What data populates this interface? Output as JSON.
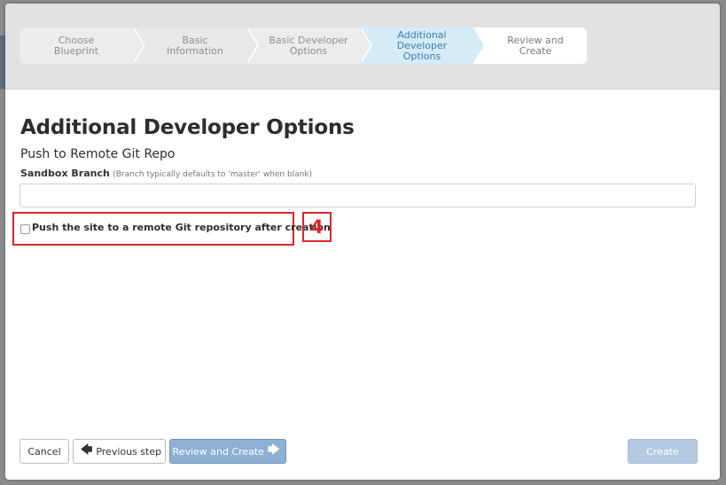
{
  "wizard": {
    "steps": [
      {
        "label": "Choose\nBlueprint",
        "state": "done"
      },
      {
        "label": "Basic\nInformation",
        "state": "done"
      },
      {
        "label": "Basic Developer\nOptions",
        "state": "done"
      },
      {
        "label": "Additional\nDeveloper\nOptions",
        "state": "active"
      },
      {
        "label": "Review and\nCreate",
        "state": "upcoming"
      }
    ]
  },
  "page": {
    "title": "Additional Developer Options",
    "section_title": "Push to Remote Git Repo"
  },
  "sandbox_branch": {
    "label": "Sandbox Branch",
    "hint": "(Branch typically defaults to 'master' when blank)",
    "value": ""
  },
  "push_option": {
    "label": "Push the site to a remote Git repository after creation",
    "checked": false
  },
  "annotation": {
    "number": "4",
    "color": "#d9262c"
  },
  "footer": {
    "cancel_label": "Cancel",
    "prev_label": "Previous step",
    "prev_icon": "arrow-left-icon",
    "review_label": "Review and Create",
    "review_icon": "arrow-right-icon",
    "create_label": "Create"
  },
  "colors": {
    "active_step_bg": "#d5ebf7",
    "active_step_text": "#3d7fb0",
    "primary_button": "#8eb0d3",
    "disabled_button": "#b3cae0"
  }
}
